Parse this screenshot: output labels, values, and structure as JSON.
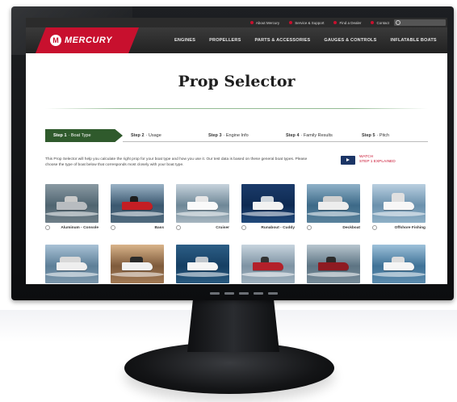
{
  "utility_nav": [
    {
      "label": "About Mercury"
    },
    {
      "label": "Service & Support"
    },
    {
      "label": "Find a Dealer"
    },
    {
      "label": "Contact"
    }
  ],
  "brand": {
    "name": "MERCURY",
    "emblem": "M",
    "color": "#c8102e"
  },
  "main_nav": [
    {
      "label": "ENGINES"
    },
    {
      "label": "PROPELLERS"
    },
    {
      "label": "PARTS & ACCESSORIES"
    },
    {
      "label": "GAUGES & CONTROLS"
    },
    {
      "label": "INFLATABLE BOATS"
    }
  ],
  "page": {
    "title": "Prop Selector",
    "intro": "This Prop Selector will help you calculate the right prop for your boat type and how you use it. Our test data is based on these general boat types. Please choose the type of boat below that corresponds most closely with your boat type.",
    "watch_line1": "WATCH",
    "watch_line2": "STEP 1 EXPLAINED"
  },
  "steps": [
    {
      "num": "Step 1",
      "label": "· Boat Type",
      "active": true
    },
    {
      "num": "Step 2",
      "label": "· Usage",
      "active": false
    },
    {
      "num": "Step 3",
      "label": "· Engine Info",
      "active": false
    },
    {
      "num": "Step 4",
      "label": "· Family Results",
      "active": false
    },
    {
      "num": "Step 5",
      "label": "· Pitch",
      "active": false
    }
  ],
  "boats": [
    {
      "label": "Aluminum - Console",
      "selected": false
    },
    {
      "label": "Bass",
      "selected": false
    },
    {
      "label": "Cruiser",
      "selected": false
    },
    {
      "label": "Runabout - Cuddy",
      "selected": false
    },
    {
      "label": "Deckboat",
      "selected": false
    },
    {
      "label": "Offshore Fishing",
      "selected": false
    },
    {
      "label": "",
      "selected": false
    },
    {
      "label": "",
      "selected": false
    },
    {
      "label": "",
      "selected": false
    },
    {
      "label": "",
      "selected": false
    },
    {
      "label": "",
      "selected": false
    },
    {
      "label": "",
      "selected": false
    }
  ],
  "colors": {
    "active_step": "#2f5a2c",
    "nav_bg": "#2b2b2b",
    "accent_red": "#c8102e"
  }
}
